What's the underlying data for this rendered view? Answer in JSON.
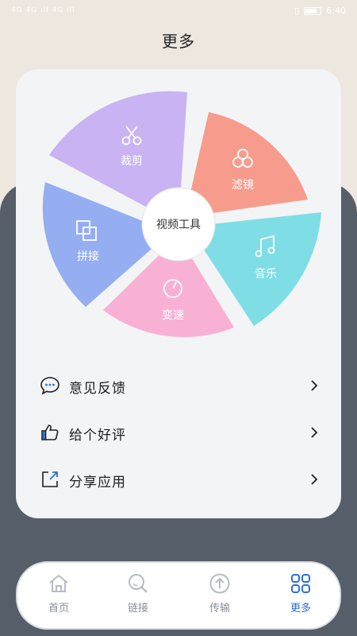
{
  "status_bar": {
    "left": "4G 4G ıll 4G ıll",
    "time": "6:40"
  },
  "page_title": "更多",
  "wheel": {
    "center": "视频工具",
    "segments": [
      {
        "label": "裁剪",
        "icon": "scissors-icon",
        "color": "#c9b3f3"
      },
      {
        "label": "滤镜",
        "icon": "filter-circles-icon",
        "color": "#f79c8c"
      },
      {
        "label": "音乐",
        "icon": "music-note-icon",
        "color": "#7fdde6"
      },
      {
        "label": "变速",
        "icon": "speed-gauge-icon",
        "color": "#f8b1d4"
      },
      {
        "label": "拼接",
        "icon": "splice-squares-icon",
        "color": "#94aef1"
      }
    ]
  },
  "menu": [
    {
      "label": "意见反馈",
      "icon": "chat-bubble-icon"
    },
    {
      "label": "给个好评",
      "icon": "thumbs-up-icon"
    },
    {
      "label": "分享应用",
      "icon": "share-icon"
    }
  ],
  "tabs": [
    {
      "label": "首页",
      "icon": "home-icon",
      "active": false
    },
    {
      "label": "链接",
      "icon": "link-search-icon",
      "active": false
    },
    {
      "label": "传输",
      "icon": "upload-icon",
      "active": false
    },
    {
      "label": "更多",
      "icon": "grid-icon",
      "active": true
    }
  ],
  "colors": {
    "accent": "#2d6fd6",
    "inactive": "#888e96",
    "dark_background": "#565e6a",
    "light_background": "#ede7e0"
  }
}
